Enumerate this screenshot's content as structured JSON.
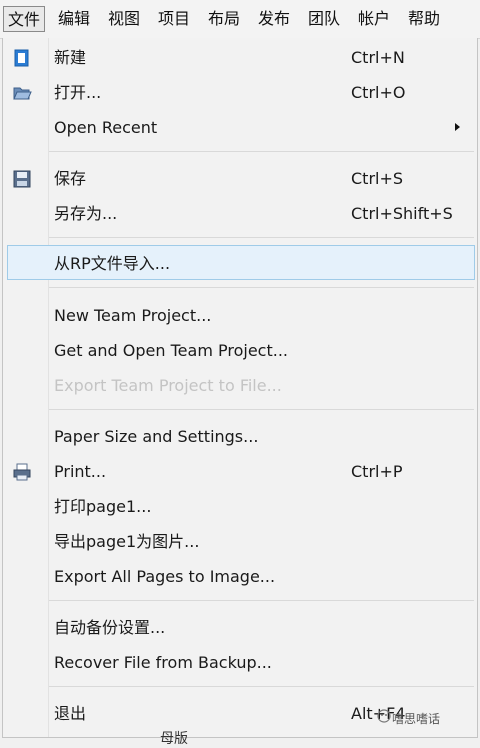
{
  "menubar": {
    "items": [
      "文件",
      "编辑",
      "视图",
      "项目",
      "布局",
      "发布",
      "团队",
      "帐户",
      "帮助"
    ]
  },
  "menu": {
    "new": {
      "label": "新建",
      "shortcut": "Ctrl+N",
      "icon": "new-file-icon"
    },
    "open": {
      "label": "打开...",
      "shortcut": "Ctrl+O",
      "icon": "open-folder-icon"
    },
    "open_recent": {
      "label": "Open Recent"
    },
    "save": {
      "label": "保存",
      "shortcut": "Ctrl+S",
      "icon": "save-disk-icon"
    },
    "save_as": {
      "label": "另存为...",
      "shortcut": "Ctrl+Shift+S"
    },
    "import_rp": {
      "label": "从RP文件导入..."
    },
    "new_team": {
      "label": "New Team Project..."
    },
    "get_open_team": {
      "label": "Get and Open Team Project..."
    },
    "export_team": {
      "label": "Export Team Project to File..."
    },
    "paper_size": {
      "label": "Paper Size and Settings..."
    },
    "print": {
      "label": "Print...",
      "shortcut": "Ctrl+P",
      "icon": "printer-icon"
    },
    "print_page1": {
      "label": "打印page1..."
    },
    "export_page1": {
      "label": "导出page1为图片..."
    },
    "export_all": {
      "label": "Export All Pages to Image..."
    },
    "auto_backup": {
      "label": "自动备份设置..."
    },
    "recover": {
      "label": "Recover File from Backup..."
    },
    "exit": {
      "label": "退出",
      "shortcut": "Alt+F4"
    }
  },
  "underlying": {
    "partial_text": "母版"
  },
  "watermark": {
    "text": "嗜思嗜话"
  },
  "colors": {
    "highlight_bg": "#e5f1fb",
    "highlight_border": "#9fcbe8",
    "disabled": "#c4c4c4"
  }
}
